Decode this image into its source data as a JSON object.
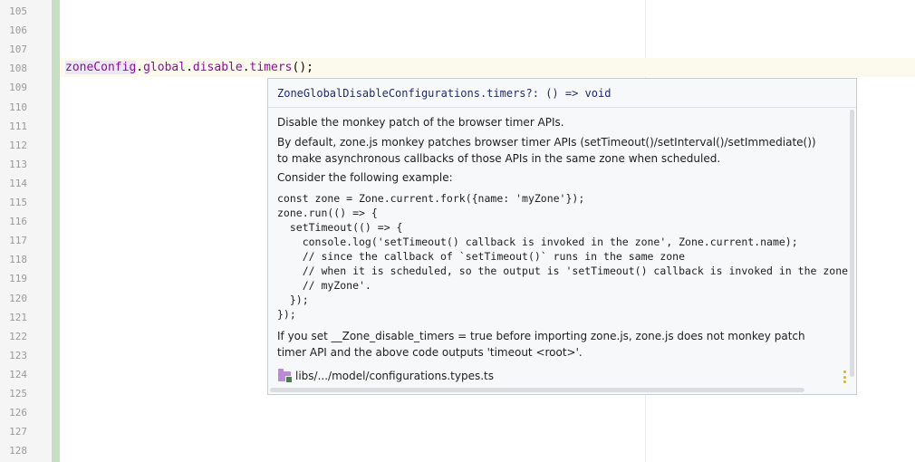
{
  "editor": {
    "line_numbers": [
      "105",
      "106",
      "107",
      "108",
      "109",
      "110",
      "111",
      "112",
      "113",
      "114",
      "115",
      "116",
      "117",
      "118",
      "119",
      "120",
      "121",
      "122",
      "123",
      "124",
      "125",
      "126",
      "127",
      "128"
    ],
    "code_tokens": {
      "var": "zoneConfig",
      "dot1": ".",
      "prop1": "global",
      "dot2": ".",
      "prop2": "disable",
      "dot3": ".",
      "method": "timers",
      "call": "();"
    }
  },
  "quick_doc": {
    "signature": "ZoneGlobalDisableConfigurations.timers?: () => void",
    "summary": "Disable the monkey patch of the browser timer APIs.",
    "para1_line1": "By default, zone.js monkey patches browser timer APIs (setTimeout()/setInterval()/setImmediate())",
    "para1_line2": "to make asynchronous callbacks of those APIs in the same zone when scheduled.",
    "para2": "Consider the following example:",
    "code_lines": [
      "const zone = Zone.current.fork({name: 'myZone'});",
      "zone.run(() => {",
      "  setTimeout(() => {",
      "    console.log('setTimeout() callback is invoked in the zone', Zone.current.name);",
      "    // since the callback of `setTimeout()` runs in the same zone",
      "    // when it is scheduled, so the output is 'setTimeout() callback is invoked in the zone",
      "    // myZone'.",
      "  });",
      "});"
    ],
    "para3_line1": "If you set __Zone_disable_timers = true before importing zone.js, zone.js does not monkey patch",
    "para3_line2": "timer API and the above code outputs 'timeout <root>'.",
    "source_path": "libs/.../model/configurations.types.ts"
  },
  "colors": {
    "gutter_divider": "#c7dfc2",
    "current_line": "#fcfaed",
    "popup_bg": "#f7f8fa",
    "folder": "#b98bd5",
    "kebab": "#e0b400"
  },
  "icons": {
    "source": "folder-icon",
    "menu": "kebab-icon"
  }
}
